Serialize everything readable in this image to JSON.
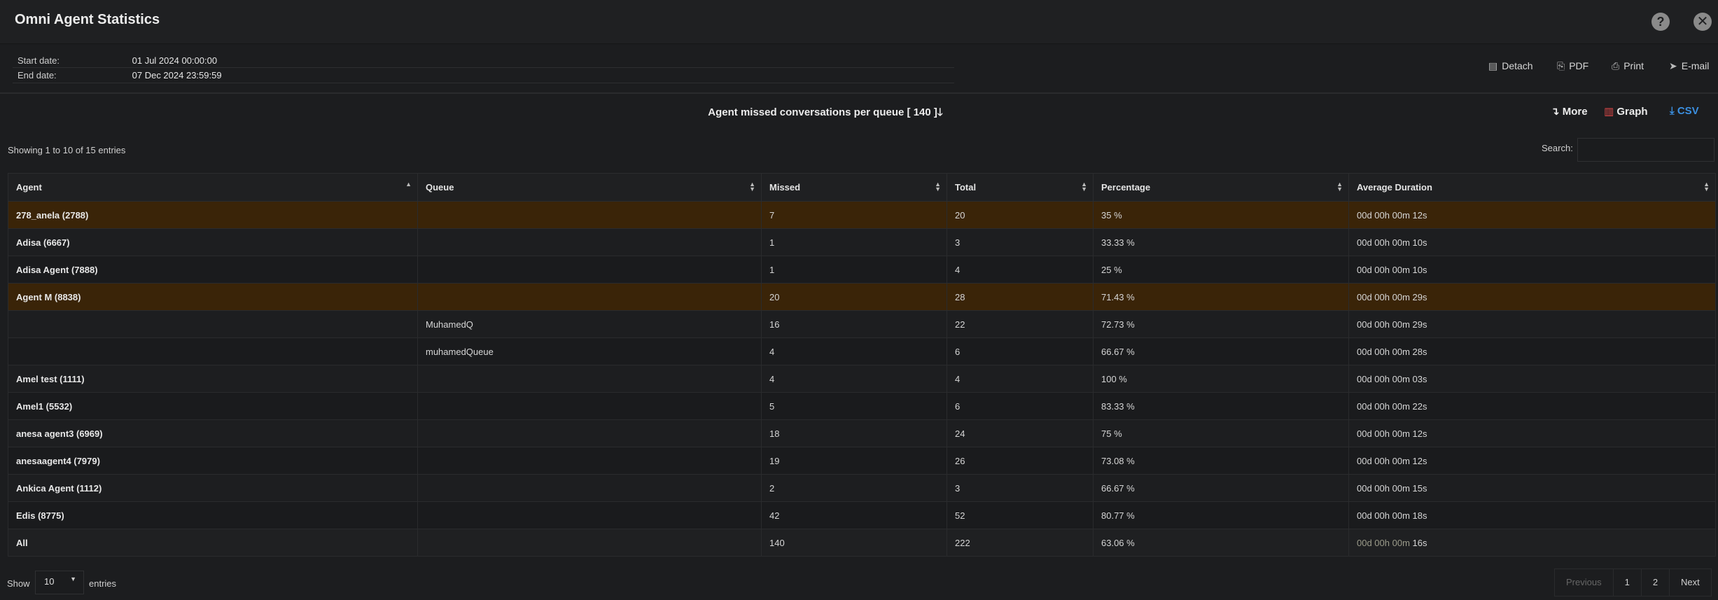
{
  "window": {
    "title": "Omni Agent Statistics",
    "help_icon": "?",
    "close_icon": "✕"
  },
  "dates": {
    "start_label": "Start date:",
    "start_value": "01 Jul 2024 00:00:00",
    "end_label": "End date:",
    "end_value": "07 Dec 2024 23:59:59"
  },
  "actions": {
    "detach": "Detach",
    "pdf": "PDF",
    "print": "Print",
    "email": "E-mail"
  },
  "report": {
    "title": "Agent missed conversations per queue [ 140 ]",
    "more": "More",
    "graph": "Graph",
    "csv": "CSV",
    "graph_color": "#e04848",
    "csv_color": "#3b8fe0"
  },
  "table_info": {
    "showing": "Showing 1 to 10 of 15 entries",
    "search_label": "Search:",
    "search_value": ""
  },
  "columns": [
    "Agent",
    "Queue",
    "Missed",
    "Total",
    "Percentage",
    "Average Duration"
  ],
  "rows": [
    {
      "agent": "278_anela (2788)",
      "queue": "",
      "missed": "7",
      "total": "20",
      "pct": "35 %",
      "dur": "00d 00h 00m 12s"
    },
    {
      "agent": "Adisa (6667)",
      "queue": "",
      "missed": "1",
      "total": "3",
      "pct": "33.33 %",
      "dur": "00d 00h 00m 10s"
    },
    {
      "agent": "Adisa Agent (7888)",
      "queue": "",
      "missed": "1",
      "total": "4",
      "pct": "25 %",
      "dur": "00d 00h 00m 10s"
    },
    {
      "agent": "Agent M (8838)",
      "queue": "",
      "missed": "20",
      "total": "28",
      "pct": "71.43 %",
      "dur": "00d 00h 00m 29s"
    },
    {
      "agent": "",
      "queue": "MuhamedQ",
      "missed": "16",
      "total": "22",
      "pct": "72.73 %",
      "dur": "00d 00h 00m 29s"
    },
    {
      "agent": "",
      "queue": "muhamedQueue",
      "missed": "4",
      "total": "6",
      "pct": "66.67 %",
      "dur": "00d 00h 00m 28s"
    },
    {
      "agent": "Amel test (1111)",
      "queue": "",
      "missed": "4",
      "total": "4",
      "pct": "100 %",
      "dur": "00d 00h 00m 03s"
    },
    {
      "agent": "Amel1 (5532)",
      "queue": "",
      "missed": "5",
      "total": "6",
      "pct": "83.33 %",
      "dur": "00d 00h 00m 22s"
    },
    {
      "agent": "anesa agent3 (6969)",
      "queue": "",
      "missed": "18",
      "total": "24",
      "pct": "75 %",
      "dur": "00d 00h 00m 12s"
    },
    {
      "agent": "anesaagent4 (7979)",
      "queue": "",
      "missed": "19",
      "total": "26",
      "pct": "73.08 %",
      "dur": "00d 00h 00m 12s"
    },
    {
      "agent": "Ankica Agent (1112)",
      "queue": "",
      "missed": "2",
      "total": "3",
      "pct": "66.67 %",
      "dur": "00d 00h 00m 15s"
    },
    {
      "agent": "Edis (8775)",
      "queue": "",
      "missed": "42",
      "total": "52",
      "pct": "80.77 %",
      "dur": "00d 00h 00m 18s"
    }
  ],
  "totals": {
    "agent": "All",
    "queue": "",
    "missed": "140",
    "total": "222",
    "pct": "63.06 %",
    "dur_prefix": "00d 00h 00m ",
    "dur_suffix": "16s"
  },
  "footer": {
    "show_label": "Show",
    "page_length": "10",
    "entries_label": "entries",
    "previous": "Previous",
    "page1": "1",
    "page2": "2",
    "next": "Next"
  },
  "colors": {
    "highlight_row": "#3a2408",
    "background": "#1c1d1f"
  }
}
